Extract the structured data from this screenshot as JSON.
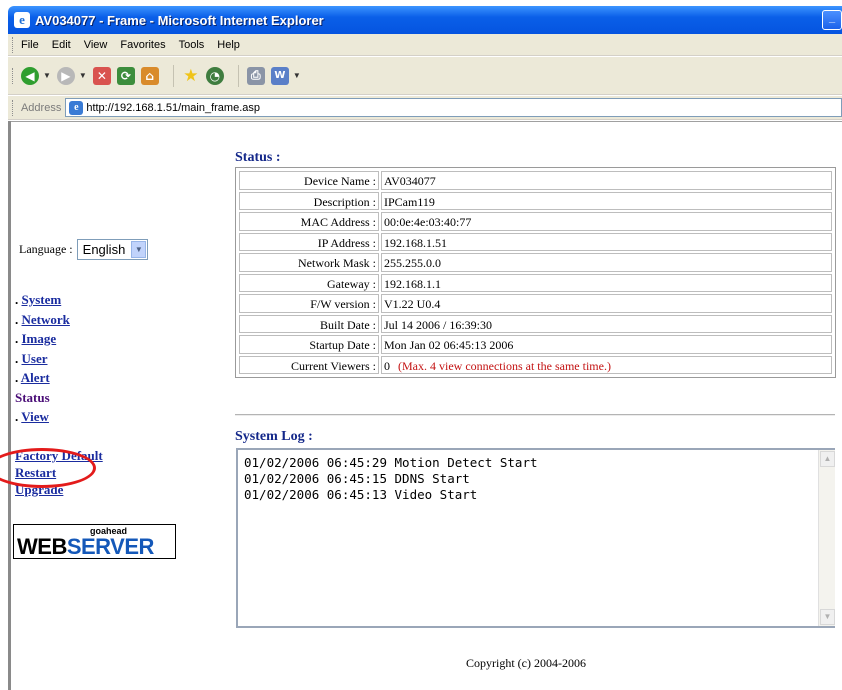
{
  "window": {
    "title": "AV034077 - Frame - Microsoft Internet Explorer",
    "minimize_glyph": "_"
  },
  "menu": {
    "items": [
      {
        "label": "File"
      },
      {
        "label": "Edit"
      },
      {
        "label": "View"
      },
      {
        "label": "Favorites"
      },
      {
        "label": "Tools"
      },
      {
        "label": "Help"
      }
    ]
  },
  "toolbar": {
    "buttons": [
      {
        "icon": "back-arrow-icon",
        "glyph": "◀",
        "color": "#2f9e2f"
      },
      {
        "icon": "forward-arrow-icon",
        "glyph": "▶",
        "color": "#b8b8b8"
      },
      {
        "icon": "stop-icon",
        "glyph": "✕",
        "color": "#d9534f"
      },
      {
        "icon": "refresh-icon",
        "glyph": "⟳",
        "color": "#3c8d3c"
      },
      {
        "icon": "home-icon",
        "glyph": "⌂",
        "color": "#d98b2b"
      },
      {
        "icon": "favorites-star-icon",
        "glyph": "★",
        "color": "#f0c419"
      },
      {
        "icon": "history-icon",
        "glyph": "◔",
        "color": "#3f7d3f"
      },
      {
        "icon": "print-icon",
        "glyph": "⎙",
        "color": "#8a94a6"
      },
      {
        "icon": "word-edit-icon",
        "glyph": "W",
        "color": "#5a7fc8"
      }
    ]
  },
  "address": {
    "label": "Address",
    "url": "http://192.168.1.51/main_frame.asp"
  },
  "sidebar": {
    "language_label": "Language :",
    "language_value": "English",
    "nav": [
      {
        "prefix": ". ",
        "label": "System",
        "link": true
      },
      {
        "prefix": ". ",
        "label": "Network",
        "link": true
      },
      {
        "prefix": ". ",
        "label": "Image",
        "link": true
      },
      {
        "prefix": ". ",
        "label": "User",
        "link": true
      },
      {
        "prefix": ". ",
        "label": "Alert",
        "link": true
      },
      {
        "prefix": "",
        "label": "Status",
        "link": false
      },
      {
        "prefix": ". ",
        "label": "View",
        "link": true
      }
    ],
    "actions": [
      {
        "label": "Factory Default"
      },
      {
        "label": "Restart"
      },
      {
        "label": "Upgrade"
      }
    ],
    "logo": {
      "small": "goahead",
      "part1": "WEB",
      "part2": "SERVER"
    }
  },
  "status": {
    "title": "Status :",
    "rows": [
      {
        "label": "Device Name :",
        "value": "AV034077"
      },
      {
        "label": "Description :",
        "value": "IPCam119"
      },
      {
        "label": "MAC Address :",
        "value": "00:0e:4e:03:40:77"
      },
      {
        "label": "IP Address :",
        "value": "192.168.1.51"
      },
      {
        "label": "Network Mask :",
        "value": "255.255.0.0"
      },
      {
        "label": "Gateway :",
        "value": "192.168.1.1"
      },
      {
        "label": "F/W version :",
        "value": "V1.22 U0.4"
      },
      {
        "label": "Built Date :",
        "value": "Jul 14 2006 / 16:39:30"
      },
      {
        "label": "Startup Date :",
        "value": "Mon Jan 02 06:45:13 2006"
      },
      {
        "label": "Current Viewers :",
        "value": "0",
        "note": "(Max. 4 view connections at the same time.)"
      }
    ]
  },
  "system_log": {
    "title": "System Log :",
    "lines": [
      "01/02/2006 06:45:29 Motion Detect Start",
      "01/02/2006 06:45:15 DDNS Start",
      "01/02/2006 06:45:13 Video Start"
    ]
  },
  "footer": {
    "copyright": "Copyright (c) 2004-2006"
  },
  "colors": {
    "link": "#1a2c9f",
    "section_title": "#14288a",
    "note_red": "#c31212",
    "annotation_circle": "#e31b1b"
  }
}
